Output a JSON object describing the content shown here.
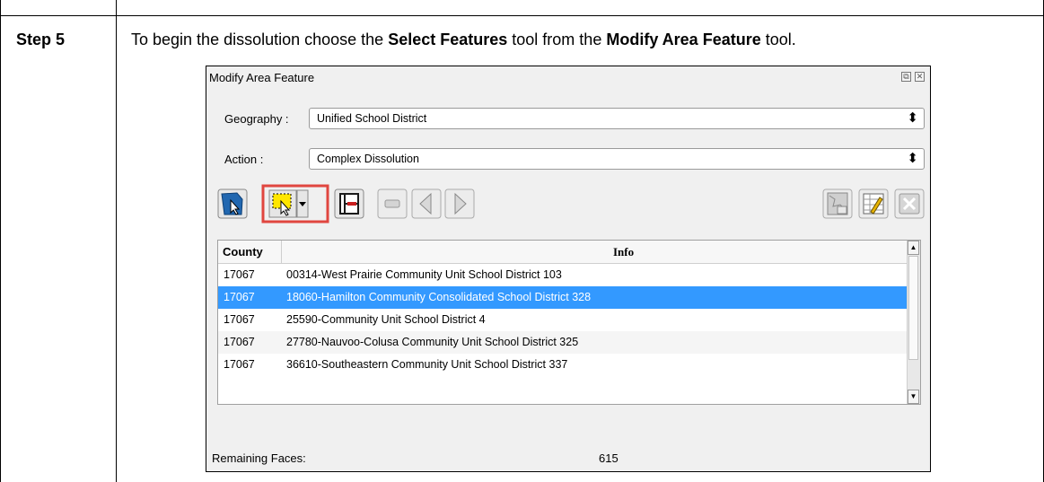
{
  "step": {
    "label": "Step 5"
  },
  "instruction": {
    "part1": "To begin the dissolution choose the ",
    "bold1": "Select Features",
    "part2": " tool from the ",
    "bold2": "Modify Area Feature",
    "part3": " tool."
  },
  "dialog": {
    "title": "Modify Area Feature",
    "geography_label": "Geography :",
    "geography_value": "Unified School District",
    "action_label": "Action :",
    "action_value": "Complex Dissolution",
    "highlight_color": "#e0463f",
    "selection_color": "#3399ff",
    "table": {
      "headers": {
        "county": "County",
        "info": "Info"
      },
      "rows": [
        {
          "county": "17067",
          "info": "00314-West Prairie Community Unit School District 103"
        },
        {
          "county": "17067",
          "info": "18060-Hamilton Community Consolidated School District 328"
        },
        {
          "county": "17067",
          "info": "25590-Community Unit School District 4"
        },
        {
          "county": "17067",
          "info": "27780-Nauvoo-Colusa Community Unit School District 325"
        },
        {
          "county": "17067",
          "info": "36610-Southeastern Community Unit School District 337"
        }
      ],
      "selected_row": 2
    },
    "remaining_faces_label": "Remaining Faces:",
    "remaining_faces_value": "615"
  }
}
